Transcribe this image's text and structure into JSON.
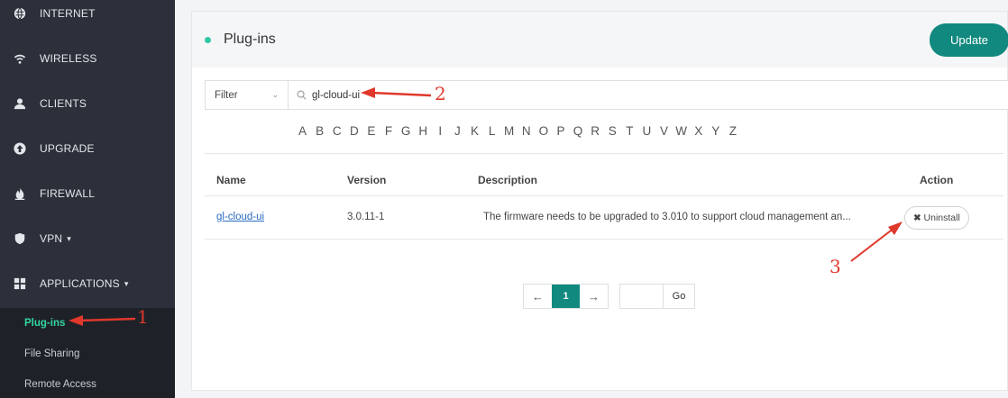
{
  "sidebar": {
    "items": [
      {
        "label": "INTERNET",
        "icon": "globe-icon"
      },
      {
        "label": "WIRELESS",
        "icon": "wifi-icon"
      },
      {
        "label": "CLIENTS",
        "icon": "user-icon"
      },
      {
        "label": "UPGRADE",
        "icon": "upgrade-icon"
      },
      {
        "label": "FIREWALL",
        "icon": "fire-icon"
      },
      {
        "label": "VPN",
        "icon": "shield-icon",
        "caret": "▾"
      },
      {
        "label": "APPLICATIONS",
        "icon": "grid-icon",
        "caret": "▾"
      }
    ],
    "subitems": [
      {
        "label": "Plug-ins",
        "active": true
      },
      {
        "label": "File Sharing"
      },
      {
        "label": "Remote Access"
      }
    ]
  },
  "header": {
    "title": "Plug-ins",
    "update_label": "Update"
  },
  "filter": {
    "select_label": "Filter",
    "search_value": "gl-cloud-ui"
  },
  "alphabet": [
    "A",
    "B",
    "C",
    "D",
    "E",
    "F",
    "G",
    "H",
    "I",
    "J",
    "K",
    "L",
    "M",
    "N",
    "O",
    "P",
    "Q",
    "R",
    "S",
    "T",
    "U",
    "V",
    "W",
    "X",
    "Y",
    "Z"
  ],
  "table": {
    "headers": {
      "name": "Name",
      "version": "Version",
      "description": "Description",
      "action": "Action"
    },
    "rows": [
      {
        "name": "gl-cloud-ui",
        "version": "3.0.11-1",
        "description": "The firmware needs to be upgraded to 3.010 to support cloud management an...",
        "action": "Uninstall"
      }
    ]
  },
  "pagination": {
    "prev": "←",
    "current": "1",
    "next": "→",
    "go_label": "Go"
  },
  "annotations": {
    "one": "1",
    "two": "2",
    "three": "3"
  },
  "colors": {
    "accent": "#12897f",
    "active_nav": "#33d6a0",
    "annotation": "#e0382b"
  }
}
